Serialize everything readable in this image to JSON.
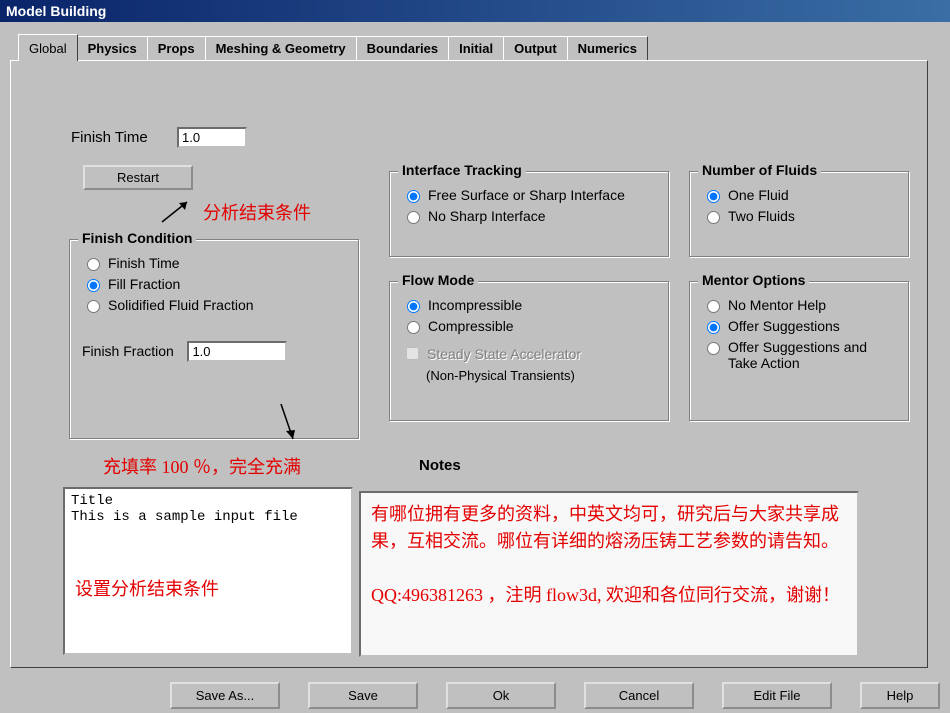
{
  "window": {
    "title": "Model Building"
  },
  "tabs": [
    "Global",
    "Physics",
    "Props",
    "Meshing & Geometry",
    "Boundaries",
    "Initial",
    "Output",
    "Numerics"
  ],
  "finish_time": {
    "label": "Finish Time",
    "value": "1.0"
  },
  "restart_btn": "Restart",
  "finish_condition": {
    "legend": "Finish Condition",
    "opts": [
      "Finish Time",
      "Fill Fraction",
      "Solidified Fluid Fraction"
    ],
    "fraction_label": "Finish Fraction",
    "fraction_value": "1.0"
  },
  "interface_tracking": {
    "legend": "Interface Tracking",
    "opts": [
      "Free Surface or Sharp Interface",
      "No Sharp Interface"
    ]
  },
  "flow_mode": {
    "legend": "Flow Mode",
    "opts": [
      "Incompressible",
      "Compressible"
    ],
    "check_label": "Steady State Accelerator",
    "subtext": "(Non-Physical Transients)"
  },
  "num_fluids": {
    "legend": "Number of Fluids",
    "opts": [
      "One Fluid",
      "Two Fluids"
    ]
  },
  "mentor": {
    "legend": "Mentor Options",
    "opts": [
      "No Mentor Help",
      "Offer Suggestions",
      "Offer Suggestions and Take Action"
    ]
  },
  "annotations": {
    "a1": "分析结束条件",
    "a2": "充填率 100 ％，完全充满",
    "a3": "设置分析结束条件"
  },
  "notes_label": "Notes",
  "title_box": "Title\nThis is a sample input file",
  "share_box": "有哪位拥有更多的资料，中英文均可，研究后与大家共享成果，互相交流。哪位有详细的熔汤压铸工艺参数的请告知。\n\nQQ:496381263 ，注明 flow3d, 欢迎和各位同行交流，谢谢！",
  "buttons": {
    "save_as": "Save As...",
    "save": "Save",
    "ok": "Ok",
    "cancel": "Cancel",
    "edit_file": "Edit File",
    "help": "Help"
  }
}
